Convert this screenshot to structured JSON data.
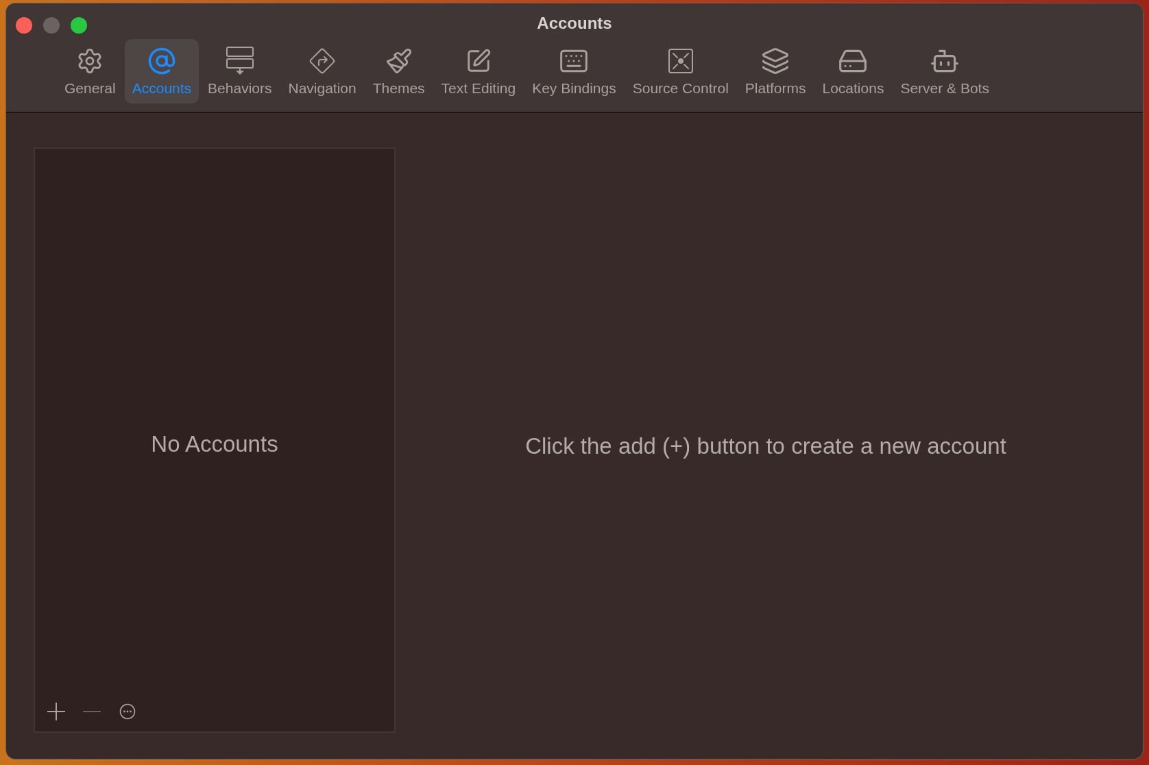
{
  "window": {
    "title": "Accounts",
    "controls": [
      {
        "kind": "close",
        "disabled": false
      },
      {
        "kind": "minimize",
        "disabled": true
      },
      {
        "kind": "zoom",
        "disabled": false
      }
    ]
  },
  "tabs": [
    {
      "kind": "general",
      "label": "General",
      "selected": false
    },
    {
      "kind": "accounts",
      "label": "Accounts",
      "selected": true
    },
    {
      "kind": "behaviors",
      "label": "Behaviors",
      "selected": false
    },
    {
      "kind": "navigation",
      "label": "Navigation",
      "selected": false
    },
    {
      "kind": "themes",
      "label": "Themes",
      "selected": false
    },
    {
      "kind": "text_editing",
      "label": "Text Editing",
      "selected": false
    },
    {
      "kind": "key_bindings",
      "label": "Key Bindings",
      "selected": false
    },
    {
      "kind": "source_control",
      "label": "Source Control",
      "selected": false
    },
    {
      "kind": "platforms",
      "label": "Platforms",
      "selected": false
    },
    {
      "kind": "locations",
      "label": "Locations",
      "selected": false
    },
    {
      "kind": "server_bots",
      "label": "Server & Bots",
      "selected": false
    }
  ],
  "accounts_list": {
    "empty_text": "No Accounts",
    "buttons": [
      {
        "kind": "add",
        "disabled": false
      },
      {
        "kind": "remove",
        "disabled": true
      },
      {
        "kind": "more",
        "disabled": false
      }
    ]
  },
  "detail": {
    "message": "Click the add (+) button to create a new account"
  }
}
